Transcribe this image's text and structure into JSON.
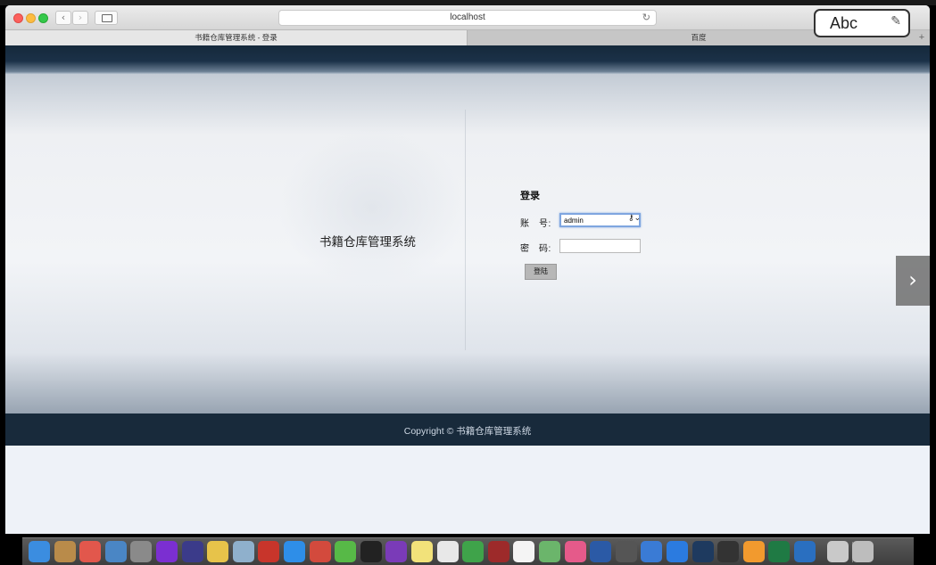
{
  "browser": {
    "address": "localhost",
    "reload_icon": "reload-icon",
    "back_icon": "chevron-left-icon",
    "forward_icon": "chevron-right-icon",
    "tabs": [
      {
        "label": "书籍仓库管理系统 - 登录",
        "active": true
      },
      {
        "label": "百度",
        "active": false
      }
    ],
    "new_tab_symbol": "+"
  },
  "input_method": {
    "label": "Abc"
  },
  "page": {
    "system_title": "书籍仓库管理系统",
    "login": {
      "title": "登录",
      "account_label": "账　号:",
      "account_value": "admin",
      "password_label": "密　码:",
      "password_value": "",
      "submit_label": "登陆"
    },
    "footer": "Copyright © 书籍仓库管理系统"
  },
  "overlay": {
    "next_icon": "chevron-right-icon"
  },
  "colors": {
    "header": "#1b3148",
    "footer": "#182a3b",
    "page_bg": "#eef2f8",
    "focus_ring": "#7fa6e0",
    "button": "#b7b7b7"
  },
  "dock": {
    "apps": [
      {
        "icon": "finder-icon",
        "color": "#3b8de0"
      },
      {
        "icon": "notes-book-icon",
        "color": "#b98b4a"
      },
      {
        "icon": "photos-icon",
        "color": "#e2574c"
      },
      {
        "icon": "preview-icon",
        "color": "#4a86c5"
      },
      {
        "icon": "launchpad-icon",
        "color": "#8a8a8a"
      },
      {
        "icon": "intellij-icon",
        "color": "#7b2fd1"
      },
      {
        "icon": "eclipse-icon",
        "color": "#3b3b8a"
      },
      {
        "icon": "folder-icon",
        "color": "#e7c34a"
      },
      {
        "icon": "database-icon",
        "color": "#8fb0cc"
      },
      {
        "icon": "redis-icon",
        "color": "#c8352b"
      },
      {
        "icon": "safari-icon",
        "color": "#2e8ee8"
      },
      {
        "icon": "mail-icon",
        "color": "#d34a3d"
      },
      {
        "icon": "wechat-icon",
        "color": "#57b947"
      },
      {
        "icon": "qq-icon",
        "color": "#222222"
      },
      {
        "icon": "axure-icon",
        "color": "#7a3bb8"
      },
      {
        "icon": "stickies-icon",
        "color": "#f2e27a"
      },
      {
        "icon": "textedit-icon",
        "color": "#e8e8e8"
      },
      {
        "icon": "settings-icon",
        "color": "#3fa34a"
      },
      {
        "icon": "instruments-icon",
        "color": "#9d2a2a"
      },
      {
        "icon": "calendar-icon",
        "color": "#f4f4f4"
      },
      {
        "icon": "maps-icon",
        "color": "#6bb56b"
      },
      {
        "icon": "music-icon",
        "color": "#e55a8a"
      },
      {
        "icon": "word-icon",
        "color": "#2b5aa6"
      },
      {
        "icon": "clock-icon",
        "color": "#555555"
      },
      {
        "icon": "baidu-netdisk-icon",
        "color": "#3a7bd5"
      },
      {
        "icon": "teamviewer-icon",
        "color": "#2b7be0"
      },
      {
        "icon": "photoshop-icon",
        "color": "#1e3a5f"
      },
      {
        "icon": "qq-penguin-icon",
        "color": "#333333"
      },
      {
        "icon": "sublime-icon",
        "color": "#f29a2e"
      },
      {
        "icon": "excel-icon",
        "color": "#1f7a44"
      },
      {
        "icon": "chrome-icon",
        "color": "#2a6fc0"
      },
      {
        "icon": "downloads-icon",
        "color": "#c9c9c9"
      },
      {
        "icon": "trash-icon",
        "color": "#bdbdbd"
      }
    ]
  }
}
